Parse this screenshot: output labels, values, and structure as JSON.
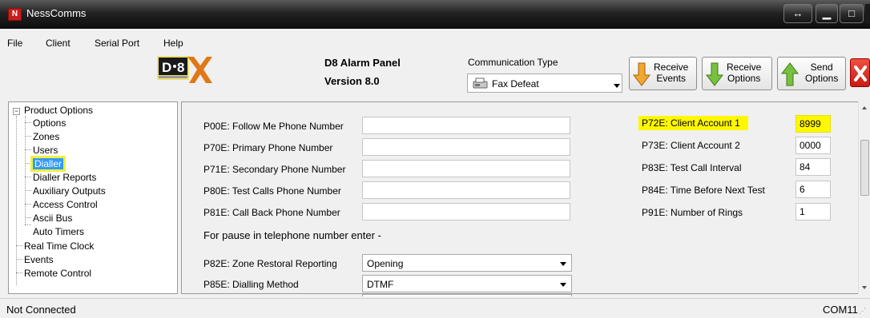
{
  "window": {
    "title": "NessComms"
  },
  "menu": [
    "File",
    "Client",
    "Serial Port",
    "Help"
  ],
  "panel": {
    "name": "D8 Alarm Panel",
    "version": "Version 8.0",
    "logo_text": "D8X"
  },
  "communication": {
    "label": "Communication Type",
    "value": "Fax Defeat"
  },
  "toolbar": {
    "receive_events": [
      "Receive",
      "Events"
    ],
    "receive_options": [
      "Receive",
      "Options"
    ],
    "send_options": [
      "Send",
      "Options"
    ]
  },
  "tree": {
    "root": "Product Options",
    "children": [
      "Options",
      "Zones",
      "Users",
      "Dialler",
      "Dialler Reports",
      "Auxiliary Outputs",
      "Access Control",
      "Ascii Bus",
      "Auto Timers"
    ],
    "selected": "Dialler",
    "top_level": [
      "Real Time Clock",
      "Events",
      "Remote Control"
    ]
  },
  "phone_fields": [
    {
      "label": "P00E: Follow Me Phone Number",
      "value": ""
    },
    {
      "label": "P70E: Primary Phone Number",
      "value": ""
    },
    {
      "label": "P71E: Secondary Phone Number",
      "value": ""
    },
    {
      "label": "P80E: Test Calls Phone Number",
      "value": ""
    },
    {
      "label": "P81E: Call Back Phone Number",
      "value": ""
    }
  ],
  "pause_note": "For pause in telephone number enter -",
  "select_fields": [
    {
      "label": "P82E: Zone Restoral Reporting",
      "value": "Opening"
    },
    {
      "label": "P85E: Dialling Method",
      "value": "DTMF"
    }
  ],
  "right_fields": [
    {
      "label": "P72E: Client Account 1",
      "value": "8999",
      "highlighted": true
    },
    {
      "label": "P73E: Client Account 2",
      "value": "0000"
    },
    {
      "label": "P83E: Test Call Interval",
      "value": "84"
    },
    {
      "label": "P84E: Time Before Next Test",
      "value": "6"
    },
    {
      "label": "P91E: Number of Rings",
      "value": "1"
    }
  ],
  "status": {
    "connection": "Not Connected",
    "port": "COM11"
  },
  "colors": {
    "highlight": "#fff800",
    "selection": "#3399ff",
    "close": "#d0281c"
  }
}
